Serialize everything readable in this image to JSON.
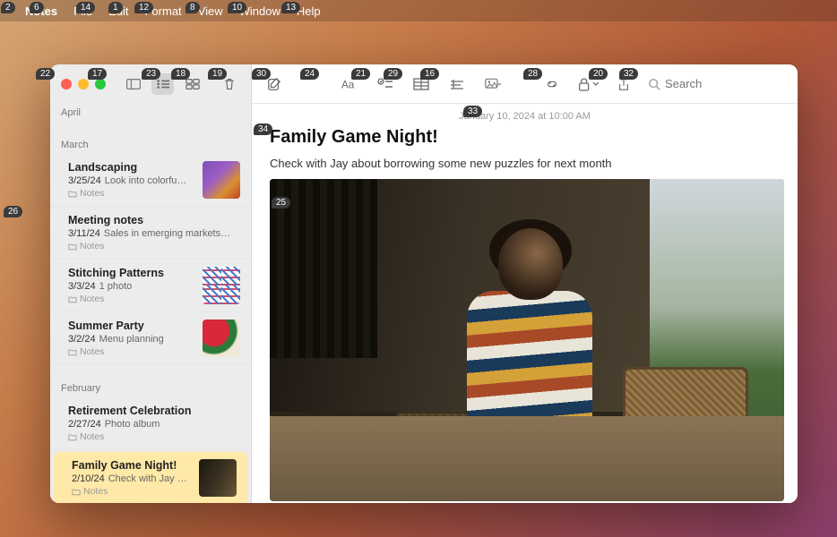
{
  "menubar": {
    "app": "Notes",
    "items": [
      "File",
      "Edit",
      "Format",
      "View",
      "Window",
      "Help"
    ]
  },
  "tags": {
    "t2": "2",
    "t6": "6",
    "t14": "14",
    "t1": "1",
    "t12": "12",
    "t8": "8",
    "t10": "10",
    "t13": "13",
    "t22": "22",
    "t17": "17",
    "t23": "23",
    "t18": "18",
    "t19": "19",
    "t30": "30",
    "t24": "24",
    "t21": "21",
    "t29": "29",
    "t16": "16",
    "t28": "28",
    "t20": "20",
    "t32": "32",
    "t33": "33",
    "t34": "34",
    "t25": "25",
    "t26": "26"
  },
  "sidebar": {
    "sections": {
      "april": "April",
      "march": "March",
      "february": "February"
    },
    "folder_label": "Notes",
    "notes": {
      "landscaping": {
        "title": "Landscaping",
        "date": "3/25/24",
        "preview": "Look into colorfu…"
      },
      "meeting": {
        "title": "Meeting notes",
        "date": "3/11/24",
        "preview": "Sales in emerging markets…"
      },
      "stitching": {
        "title": "Stitching Patterns",
        "date": "3/3/24",
        "preview": "1 photo"
      },
      "summer": {
        "title": "Summer Party",
        "date": "3/2/24",
        "preview": "Menu planning"
      },
      "retirement": {
        "title": "Retirement Celebration",
        "date": "2/27/24",
        "preview": "Photo album"
      },
      "gamenight": {
        "title": "Family Game Night!",
        "date": "2/10/24",
        "preview": "Check with Jay a…"
      }
    }
  },
  "search": {
    "placeholder": "Search"
  },
  "note": {
    "timestamp": "January 10, 2024 at 10:00 AM",
    "title": "Family Game Night!",
    "body": "Check with Jay about borrowing some new puzzles for next month"
  }
}
